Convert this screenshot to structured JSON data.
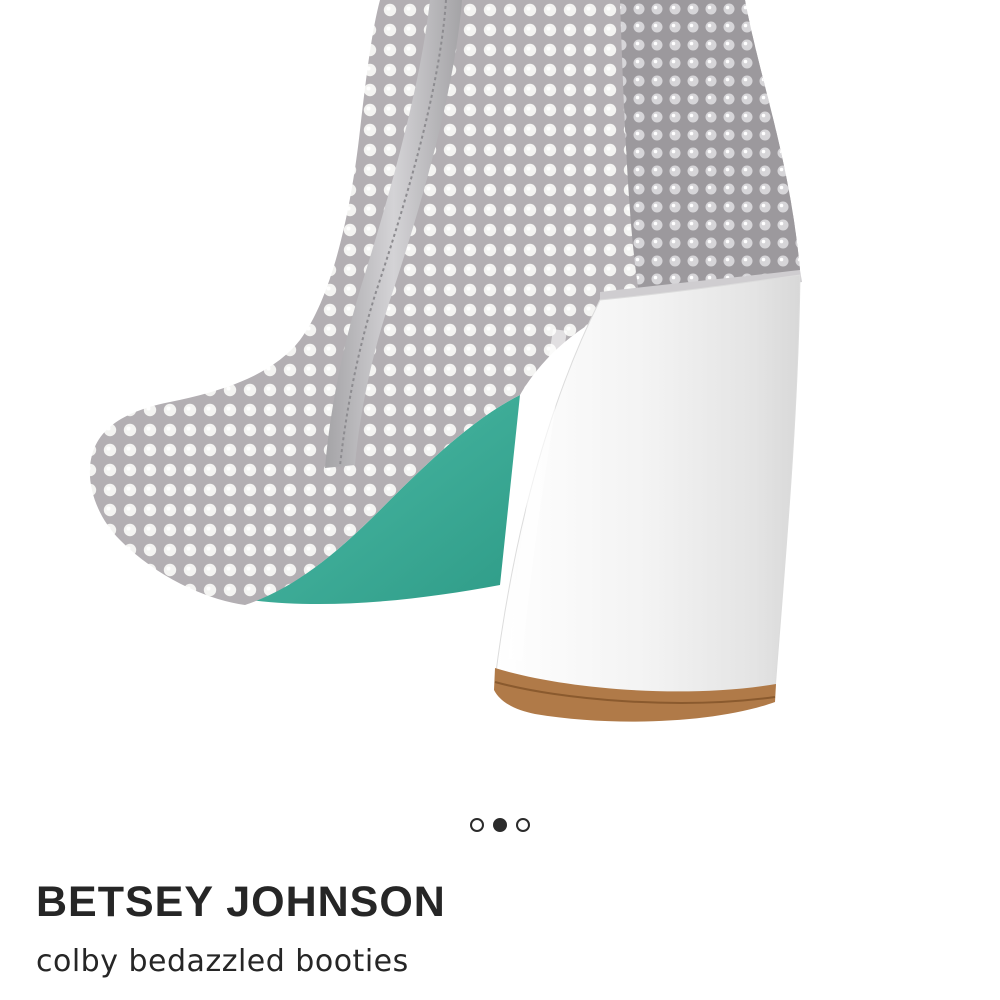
{
  "product": {
    "brand": "BETSEY JOHNSON",
    "name": "colby bedazzled booties"
  },
  "carousel": {
    "total_images": 3,
    "active_index": 1,
    "image_alt": "silver rhinestone-studded ankle bootie with block heel and teal sole"
  },
  "colors": {
    "text": "#262626",
    "dot": "#2b2b2b",
    "sole": "#3fae9a",
    "heel": "#f1f1f1",
    "rhinestone_base": "#b9b6b8"
  }
}
